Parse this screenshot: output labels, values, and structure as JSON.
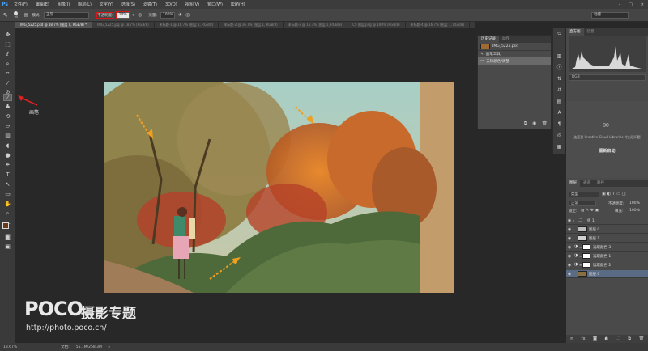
{
  "app": {
    "logo": "Ps"
  },
  "menubar": {
    "items": [
      "文件(F)",
      "编辑(E)",
      "图像(I)",
      "图层(L)",
      "文字(Y)",
      "选择(S)",
      "滤镜(T)",
      "3D(D)",
      "视图(V)",
      "窗口(W)",
      "帮助(H)"
    ]
  },
  "options": {
    "brush_size": "95",
    "mode_label": "模式:",
    "mode_value": "正常",
    "opacity_label": "不透明度:",
    "opacity_value": "10%",
    "flow_label": "流量:",
    "flow_value": "100%",
    "workspace": "动感"
  },
  "tabs": [
    "IMG_5225.psd @ 18.7% (图层 0, RGB/8) *",
    "IMG_5225.jpg @ 18.7% (RGB/8)",
    "未标题-1 @ 16.7% (图层 1, RGB/8)",
    "未标题-2 @ 16.7% (图层 1, RGB/8)",
    "未标题-3 @ 16.7% (图层 1, RGB/8)",
    "CS 图层.png @ 100% (RGB/8)",
    "未标题-4 @ 16.7% (图层 1, RGB/8)"
  ],
  "annotation": {
    "label": "画笔",
    "arrow_color": "#e02020"
  },
  "history": {
    "tabs": [
      "历史记录",
      "动作"
    ],
    "snapshot": "IMG_5225.psd",
    "items": [
      "画笔工具",
      "去除颜色/调整"
    ]
  },
  "histogram": {
    "tabs": [
      "直方图",
      "信息"
    ],
    "channel": "RGB"
  },
  "creative_cloud": {
    "message": "连接到 Creative Cloud Libraries 时出现问题",
    "retry": "重新启动"
  },
  "layers": {
    "tabs": [
      "图层",
      "通道",
      "路径"
    ],
    "kind_label": "类型",
    "blend_mode": "正常",
    "opacity_label": "不透明度:",
    "opacity_value": "100%",
    "lock_label": "锁定:",
    "fill_label": "填充:",
    "fill_value": "100%",
    "rows": [
      {
        "name": "组 1",
        "type": "group"
      },
      {
        "name": "图层 0",
        "type": "pixel",
        "thumb": "#bcbcbc"
      },
      {
        "name": "图层 1",
        "type": "pixel",
        "thumb": "#d0d0d0"
      },
      {
        "name": "选取颜色 3",
        "type": "adjust"
      },
      {
        "name": "选取颜色 1",
        "type": "adjust"
      },
      {
        "name": "选取颜色 2",
        "type": "adjust"
      },
      {
        "name": "图层 0",
        "type": "photo",
        "thumb": "#8a7040",
        "selected": true
      }
    ]
  },
  "status": {
    "zoom": "18.67%",
    "doc_label": "文档:",
    "doc_size": "55.1M/258.3M"
  },
  "watermark": {
    "brand": "POCO",
    "title": "摄影专题",
    "url": "http://photo.poco.cn/"
  },
  "colors": {
    "accent": "#d41818",
    "selection": "#5a6b85",
    "ps_blue": "#4aa8ff"
  }
}
